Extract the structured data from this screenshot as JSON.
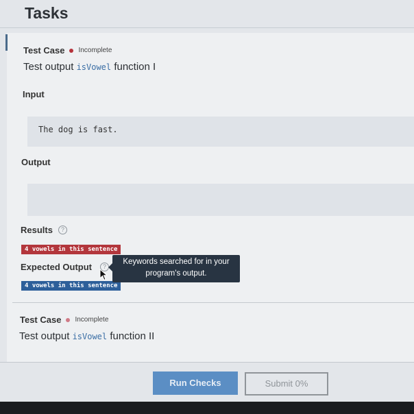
{
  "page": {
    "title": "Tasks"
  },
  "test_case_1": {
    "label": "Test Case",
    "status": "Incomplete",
    "title_prefix": "Test output",
    "title_code": "isVowel",
    "title_suffix": "function I",
    "input_label": "Input",
    "input_value": "The dog is fast.",
    "output_label": "Output",
    "output_value": "",
    "results_label": "Results",
    "results_badge": "4 vowels in this sentence",
    "expected_label": "Expected Output",
    "expected_badge": "4 vowels in this sentence",
    "tooltip": "Keywords searched for in your program's output."
  },
  "test_case_2": {
    "label": "Test Case",
    "status": "Incomplete",
    "title_prefix": "Test output",
    "title_code": "isVowel",
    "title_suffix": "function II"
  },
  "icons": {
    "help": "question-circle-icon",
    "cursor": "mouse-pointer-icon",
    "status": "status-dot-icon"
  },
  "actions": {
    "run_checks": "Run Checks",
    "submit": "Submit 0%"
  },
  "colors": {
    "fail_badge": "#b3363c",
    "expected_badge": "#2d5f9a",
    "primary_button": "#5b8ec4",
    "tooltip_bg": "#283442"
  }
}
